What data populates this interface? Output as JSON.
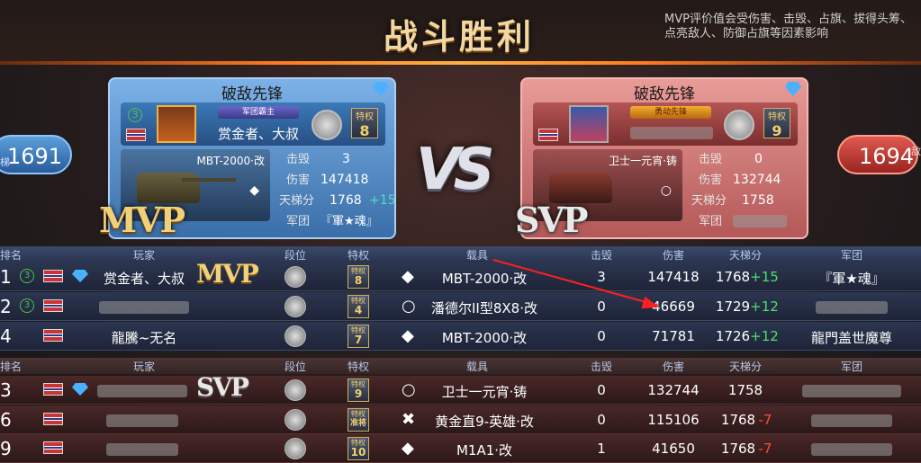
{
  "header": {
    "title": "战斗胜利",
    "mvp_note": "MVP评价值会受伤害、击毁、占旗、拔得头筹、点亮敌人、防御占旗等因素影响"
  },
  "left_score": {
    "value": "1691",
    "tag": "梯"
  },
  "right_score": {
    "value": "1694",
    "tag": "敌"
  },
  "vs": "VS",
  "mvp_card": {
    "title": "破敌先锋",
    "level": "3",
    "guild": "军团霸主",
    "player": "赏金者、大叔",
    "privilege_label": "特权",
    "privilege": "8",
    "vehicle": "MBT-2000·改",
    "vehicle_mark": "◆",
    "kills_label": "击毁",
    "kills": "3",
    "damage_label": "伤害",
    "damage": "147418",
    "ladder_label": "天梯分",
    "ladder": "1768",
    "ladder_delta": "+15",
    "legion_label": "军团",
    "legion": "『軍★魂』",
    "badge": "MVP"
  },
  "svp_card": {
    "title": "破敌先锋",
    "guild": "勇动先锋",
    "privilege_label": "特权",
    "privilege": "9",
    "vehicle": "卫士一元宵·铸",
    "vehicle_mark": "○",
    "kills_label": "击毁",
    "kills": "0",
    "damage_label": "伤害",
    "damage": "132744",
    "ladder_label": "天梯分",
    "ladder": "1758",
    "legion_label": "军团",
    "badge": "SVP"
  },
  "table_headers": {
    "rank": "排名",
    "player": "玩家",
    "tier": "段位",
    "privilege": "特权",
    "vehicle": "载具",
    "kills": "击毁",
    "damage": "伤害",
    "ladder": "天梯分",
    "legion": "军团"
  },
  "team_blue": [
    {
      "rank": "1",
      "level": "3",
      "player": "赏金者、大叔",
      "privilege_label": "特权",
      "privilege": "8",
      "mark": "◆",
      "vehicle": "MBT-2000·改",
      "kills": "3",
      "damage": "147418",
      "ladder": "1768",
      "delta": "+15",
      "legion": "『軍★魂』",
      "badge": "MVP"
    },
    {
      "rank": "2",
      "level": "3",
      "player": "",
      "privilege_label": "特权",
      "privilege": "4",
      "mark": "○",
      "vehicle": "潘德尔II型8X8·改",
      "kills": "0",
      "damage": "46669",
      "ladder": "1729",
      "delta": "+12",
      "legion": ""
    },
    {
      "rank": "4",
      "level": "",
      "player": "龍騰~无名",
      "privilege_label": "特权",
      "privilege": "7",
      "mark": "◆",
      "vehicle": "MBT-2000·改",
      "kills": "0",
      "damage": "71781",
      "ladder": "1726",
      "delta": "+12",
      "legion": "龍門盖世魔尊"
    }
  ],
  "team_red": [
    {
      "rank": "3",
      "player": "",
      "privilege_label": "特权",
      "privilege": "9",
      "mark": "○",
      "vehicle": "卫士一元宵·铸",
      "kills": "0",
      "damage": "132744",
      "ladder": "1758",
      "delta": "",
      "legion": "",
      "badge": "SVP"
    },
    {
      "rank": "6",
      "player": "",
      "privilege_label": "特权",
      "privilege": "准将",
      "mark": "✖",
      "vehicle": "黄金直9-英雄·改",
      "kills": "0",
      "damage": "115106",
      "ladder": "1768",
      "delta": "-7",
      "legion": ""
    },
    {
      "rank": "9",
      "player": "",
      "privilege_label": "特权",
      "privilege": "10",
      "mark": "◆",
      "vehicle": "M1A1·改",
      "kills": "1",
      "damage": "41650",
      "ladder": "1768",
      "delta": "-7",
      "legion": ""
    }
  ],
  "colors": {
    "accent_orange": "#ff7a20",
    "plus": "#4de06a",
    "minus": "#ff4a3a",
    "annotation": "#ff2020"
  }
}
